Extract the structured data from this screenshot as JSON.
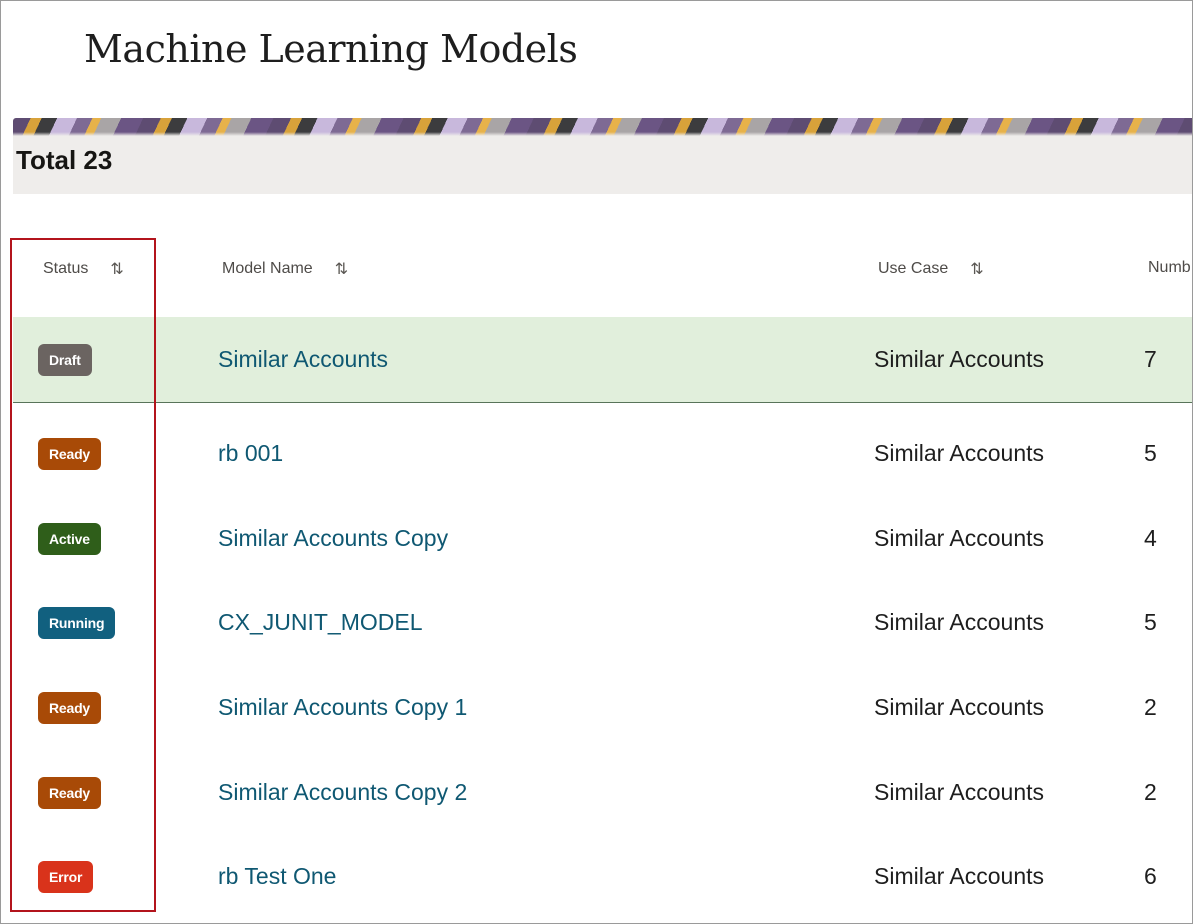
{
  "page": {
    "title": "Machine Learning Models"
  },
  "summary": {
    "total_label": "Total 23"
  },
  "table": {
    "columns": [
      {
        "label": "Status"
      },
      {
        "label": "Model Name"
      },
      {
        "label": "Use Case"
      },
      {
        "label": "Numb"
      }
    ],
    "rows": [
      {
        "status": "Draft",
        "status_color": "#6b6461",
        "model": "Similar Accounts",
        "use_case": "Similar Accounts",
        "number": "7",
        "selected": true
      },
      {
        "status": "Ready",
        "status_color": "#a84a07",
        "model": "rb 001",
        "use_case": "Similar Accounts",
        "number": "5"
      },
      {
        "status": "Active",
        "status_color": "#2f5e1a",
        "model": "Similar Accounts Copy",
        "use_case": "Similar Accounts",
        "number": "4"
      },
      {
        "status": "Running",
        "status_color": "#11607f",
        "model": "CX_JUNIT_MODEL",
        "use_case": "Similar Accounts",
        "number": "5"
      },
      {
        "status": "Ready",
        "status_color": "#a84a07",
        "model": "Similar Accounts Copy 1",
        "use_case": "Similar Accounts",
        "number": "2"
      },
      {
        "status": "Ready",
        "status_color": "#a84a07",
        "model": "Similar Accounts Copy 2",
        "use_case": "Similar Accounts",
        "number": "2"
      },
      {
        "status": "Error",
        "status_color": "#d9331b",
        "model": "rb Test One",
        "use_case": "Similar Accounts",
        "number": "6"
      }
    ]
  },
  "icons": {
    "sort": "sort-arrows-icon"
  }
}
